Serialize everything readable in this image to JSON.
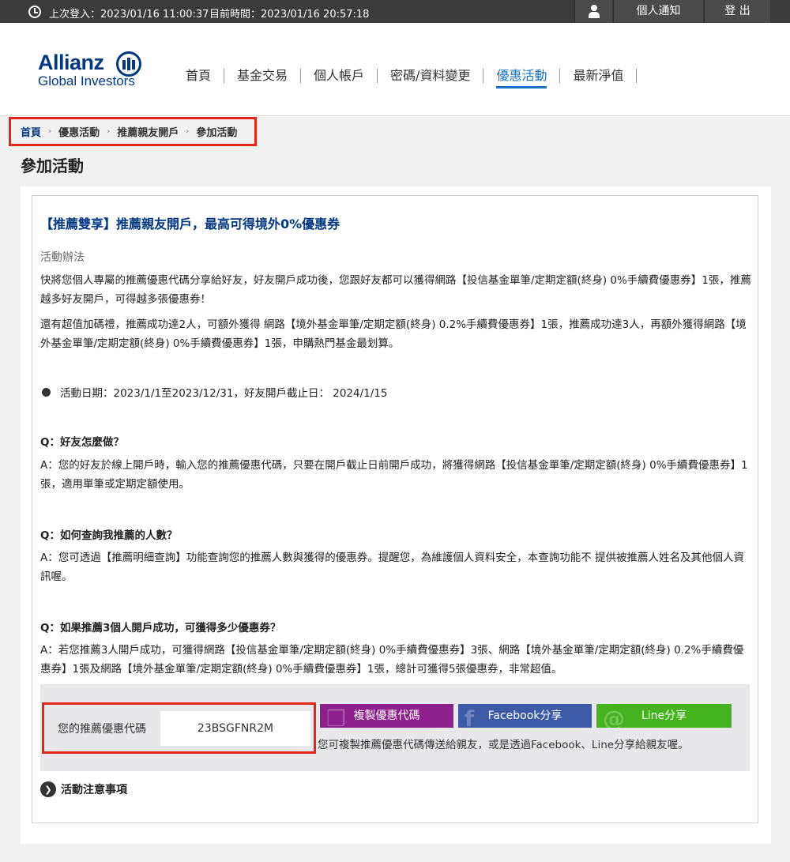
{
  "topbar": {
    "last_login": "上次登入：2023/01/16 11:00:37",
    "current_time": "目前時間：2023/01/16 20:57:18",
    "notice_label": "個人通知",
    "logout_label": "登 出"
  },
  "logo": {
    "brand": "Allianz",
    "sub": "Global Investors"
  },
  "nav": {
    "items": [
      {
        "label": "首頁"
      },
      {
        "label": "基金交易"
      },
      {
        "label": "個人帳戶"
      },
      {
        "label": "密碼/資料變更"
      },
      {
        "label": "優惠活動",
        "active": true
      },
      {
        "label": "最新淨值"
      }
    ]
  },
  "breadcrumb": [
    "首頁",
    "優惠活動",
    "推薦親友開戶",
    "參加活動"
  ],
  "page_title": "參加活動",
  "campaign": {
    "title": "【推薦雙享】推薦親友開戶，最高可得境外0%優惠券",
    "section_label": "活動辦法",
    "para1": "快將您個人專屬的推薦優惠代碼分享給好友，好友開戶成功後，您跟好友都可以獲得網路【投信基金單筆/定期定額(終身) 0%手續費優惠券】1張，推薦越多好友開戶，可得越多張優惠券！",
    "para2": "還有超值加碼禮，推薦成功達2人，可額外獲得 網路【境外基金單筆/定期定額(終身) 0.2%手續費優惠券】1張，推薦成功達3人，再額外獲得網路【境外基金單筆/定期定額(終身) 0%手續費優惠券】1張，申購熱門基金最划算。",
    "date_line": "活動日期：2023/1/1至2023/12/31，好友開戶截止日： 2024/1/15",
    "faq": [
      {
        "q": "Q：好友怎麼做？",
        "a": "A：您的好友於線上開戶時，輸入您的推薦優惠代碼，只要在開戶截止日前開戶成功，將獲得網路【投信基金單筆/定期定額(終身) 0%手續費優惠券】1張，適用單筆或定期定額使用。"
      },
      {
        "q": "Q：如何查詢我推薦的人數？",
        "a": "A：您可透過【推薦明細查詢】功能查詢您的推薦人數與獲得的優惠券。提醒您，為維護個人資料安全，本查詢功能不 提供被推薦人姓名及其他個人資訊喔。"
      },
      {
        "q": "Q：如果推薦3個人開戶成功，可獲得多少優惠券？",
        "a": "A：若您推薦3人開戶成功，可獲得網路【投信基金單筆/定期定額(終身) 0%手續費優惠券】3張、網路【境外基金單筆/定期定額(終身) 0.2%手續費優惠券】1張及網路【境外基金單筆/定期定額(終身) 0%手續費優惠券】1張，總計可獲得5張優惠券，非常超值。"
      }
    ]
  },
  "share": {
    "code_label": "您的推薦優惠代碼",
    "code_value": "23BSGFNR2M",
    "copy_label": "複製優惠代碼",
    "facebook_label": "Facebook分享",
    "line_label": "Line分享",
    "hint": "您可複製推薦優惠代碼傳送給親友，或是透過Facebook、Line分享給親友喔。"
  },
  "notice_label": "活動注意事項",
  "colors": {
    "brand_blue": "#003781",
    "active_nav": "#1672c4",
    "highlight_red": "#e1251b",
    "copy_purple": "#8e208d",
    "facebook_blue": "#3d5aa7",
    "line_green": "#44b31f"
  }
}
